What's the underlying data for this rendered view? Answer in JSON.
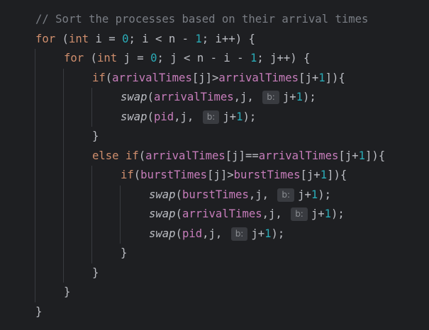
{
  "colors": {
    "background": "#1e1f22",
    "plain": "#bcbec4",
    "comment": "#7a7e85",
    "keyword": "#cf8e6d",
    "variable": "#c77dbb",
    "number": "#2aacb8",
    "function": "#56a8f5",
    "hint_bg": "#393b40",
    "hint_text": "#8c8f94",
    "indent_guide": "#393b40"
  },
  "code": [
    {
      "tokens": [
        {
          "t": "comment",
          "v": "// Sort the processes based on their arrival times"
        }
      ]
    },
    {
      "tokens": [
        {
          "t": "keyword",
          "v": "for"
        },
        {
          "t": "punct",
          "v": " ("
        },
        {
          "t": "keyword",
          "v": "int"
        },
        {
          "t": "plain",
          "v": " i "
        },
        {
          "t": "op",
          "v": "= "
        },
        {
          "t": "number",
          "v": "0"
        },
        {
          "t": "punct",
          "v": "; i "
        },
        {
          "t": "op",
          "v": "< "
        },
        {
          "t": "plain",
          "v": "n "
        },
        {
          "t": "op",
          "v": "- "
        },
        {
          "t": "number",
          "v": "1"
        },
        {
          "t": "punct",
          "v": "; i++) {"
        }
      ]
    },
    {
      "tokens": [
        {
          "t": "keyword",
          "v": "for"
        },
        {
          "t": "punct",
          "v": " ("
        },
        {
          "t": "keyword",
          "v": "int"
        },
        {
          "t": "plain",
          "v": " j "
        },
        {
          "t": "op",
          "v": "= "
        },
        {
          "t": "number",
          "v": "0"
        },
        {
          "t": "punct",
          "v": "; j "
        },
        {
          "t": "op",
          "v": "< "
        },
        {
          "t": "plain",
          "v": "n "
        },
        {
          "t": "op",
          "v": "- "
        },
        {
          "t": "plain",
          "v": "i "
        },
        {
          "t": "op",
          "v": "- "
        },
        {
          "t": "number",
          "v": "1"
        },
        {
          "t": "punct",
          "v": "; j++) {"
        }
      ]
    },
    {
      "tokens": [
        {
          "t": "keyword",
          "v": "if"
        },
        {
          "t": "punct",
          "v": "("
        },
        {
          "t": "var",
          "v": "arrivalTimes"
        },
        {
          "t": "punct",
          "v": "[j]>"
        },
        {
          "t": "var",
          "v": "arrivalTimes"
        },
        {
          "t": "punct",
          "v": "[j+"
        },
        {
          "t": "number",
          "v": "1"
        },
        {
          "t": "punct",
          "v": "]){"
        }
      ]
    },
    {
      "tokens": [
        {
          "t": "fn-italic",
          "v": "swap"
        },
        {
          "t": "punct",
          "v": "("
        },
        {
          "t": "var",
          "v": "arrivalTimes"
        },
        {
          "t": "punct",
          "v": ",j, "
        },
        {
          "t": "hint",
          "v": "b:"
        },
        {
          "t": "plain",
          "v": "j+"
        },
        {
          "t": "number",
          "v": "1"
        },
        {
          "t": "punct",
          "v": ");"
        }
      ]
    },
    {
      "tokens": [
        {
          "t": "fn-italic",
          "v": "swap"
        },
        {
          "t": "punct",
          "v": "("
        },
        {
          "t": "var",
          "v": "pid"
        },
        {
          "t": "punct",
          "v": ",j, "
        },
        {
          "t": "hint",
          "v": "b:"
        },
        {
          "t": "plain",
          "v": "j+"
        },
        {
          "t": "number",
          "v": "1"
        },
        {
          "t": "punct",
          "v": ");"
        }
      ]
    },
    {
      "tokens": [
        {
          "t": "punct",
          "v": "}"
        }
      ]
    },
    {
      "tokens": [
        {
          "t": "keyword",
          "v": "else if"
        },
        {
          "t": "punct",
          "v": "("
        },
        {
          "t": "var",
          "v": "arrivalTimes"
        },
        {
          "t": "punct",
          "v": "[j]=="
        },
        {
          "t": "var",
          "v": "arrivalTimes"
        },
        {
          "t": "punct",
          "v": "[j+"
        },
        {
          "t": "number",
          "v": "1"
        },
        {
          "t": "punct",
          "v": "]){"
        }
      ]
    },
    {
      "tokens": [
        {
          "t": "keyword",
          "v": "if"
        },
        {
          "t": "punct",
          "v": "("
        },
        {
          "t": "var",
          "v": "burstTimes"
        },
        {
          "t": "punct",
          "v": "[j]>"
        },
        {
          "t": "var",
          "v": "burstTimes"
        },
        {
          "t": "punct",
          "v": "[j+"
        },
        {
          "t": "number",
          "v": "1"
        },
        {
          "t": "punct",
          "v": "]){"
        }
      ]
    },
    {
      "tokens": [
        {
          "t": "fn-italic",
          "v": "swap"
        },
        {
          "t": "punct",
          "v": "("
        },
        {
          "t": "var",
          "v": "burstTimes"
        },
        {
          "t": "punct",
          "v": ",j, "
        },
        {
          "t": "hint",
          "v": "b:"
        },
        {
          "t": "plain",
          "v": "j+"
        },
        {
          "t": "number",
          "v": "1"
        },
        {
          "t": "punct",
          "v": ");"
        }
      ]
    },
    {
      "tokens": [
        {
          "t": "fn-italic",
          "v": "swap"
        },
        {
          "t": "punct",
          "v": "("
        },
        {
          "t": "var",
          "v": "arrivalTimes"
        },
        {
          "t": "punct",
          "v": ",j, "
        },
        {
          "t": "hint",
          "v": "b:"
        },
        {
          "t": "plain",
          "v": "j+"
        },
        {
          "t": "number",
          "v": "1"
        },
        {
          "t": "punct",
          "v": ");"
        }
      ]
    },
    {
      "tokens": [
        {
          "t": "fn-italic",
          "v": "swap"
        },
        {
          "t": "punct",
          "v": "("
        },
        {
          "t": "var",
          "v": "pid"
        },
        {
          "t": "punct",
          "v": ",j, "
        },
        {
          "t": "hint",
          "v": "b:"
        },
        {
          "t": "plain",
          "v": "j+"
        },
        {
          "t": "number",
          "v": "1"
        },
        {
          "t": "punct",
          "v": ");"
        }
      ]
    },
    {
      "tokens": [
        {
          "t": "punct",
          "v": "}"
        }
      ]
    },
    {
      "tokens": [
        {
          "t": "punct",
          "v": "}"
        }
      ]
    },
    {
      "tokens": [
        {
          "t": "punct",
          "v": "}"
        }
      ]
    },
    {
      "tokens": [
        {
          "t": "punct",
          "v": "}"
        }
      ]
    }
  ]
}
